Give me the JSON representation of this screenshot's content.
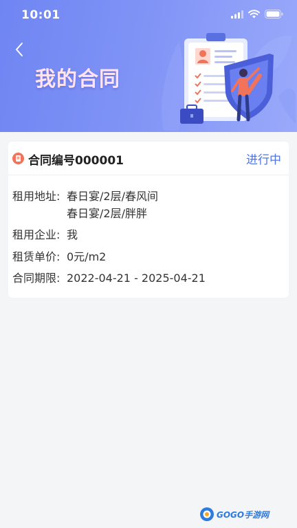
{
  "status_bar": {
    "time": "10:01"
  },
  "header": {
    "title": "我的合同"
  },
  "contract": {
    "number_label": "合同编号000001",
    "status": "进行中",
    "fields": {
      "address_label": "租用地址:",
      "address_line1": "春日宴/2层/春风间",
      "address_line2": "春日宴/2层/胖胖",
      "company_label": "租用企业:",
      "company_value": "我",
      "price_label": "租赁单价:",
      "price_value": "0元/m2",
      "period_label": "合同期限:",
      "period_value": "2022-04-21 - 2025-04-21"
    }
  },
  "watermark": {
    "text": "GOGO手游网"
  },
  "colors": {
    "header_gradient_start": "#6f85f2",
    "accent_blue": "#4a74e9",
    "doc_icon_orange": "#f0735a",
    "title_pink": "#ffe4ef"
  }
}
